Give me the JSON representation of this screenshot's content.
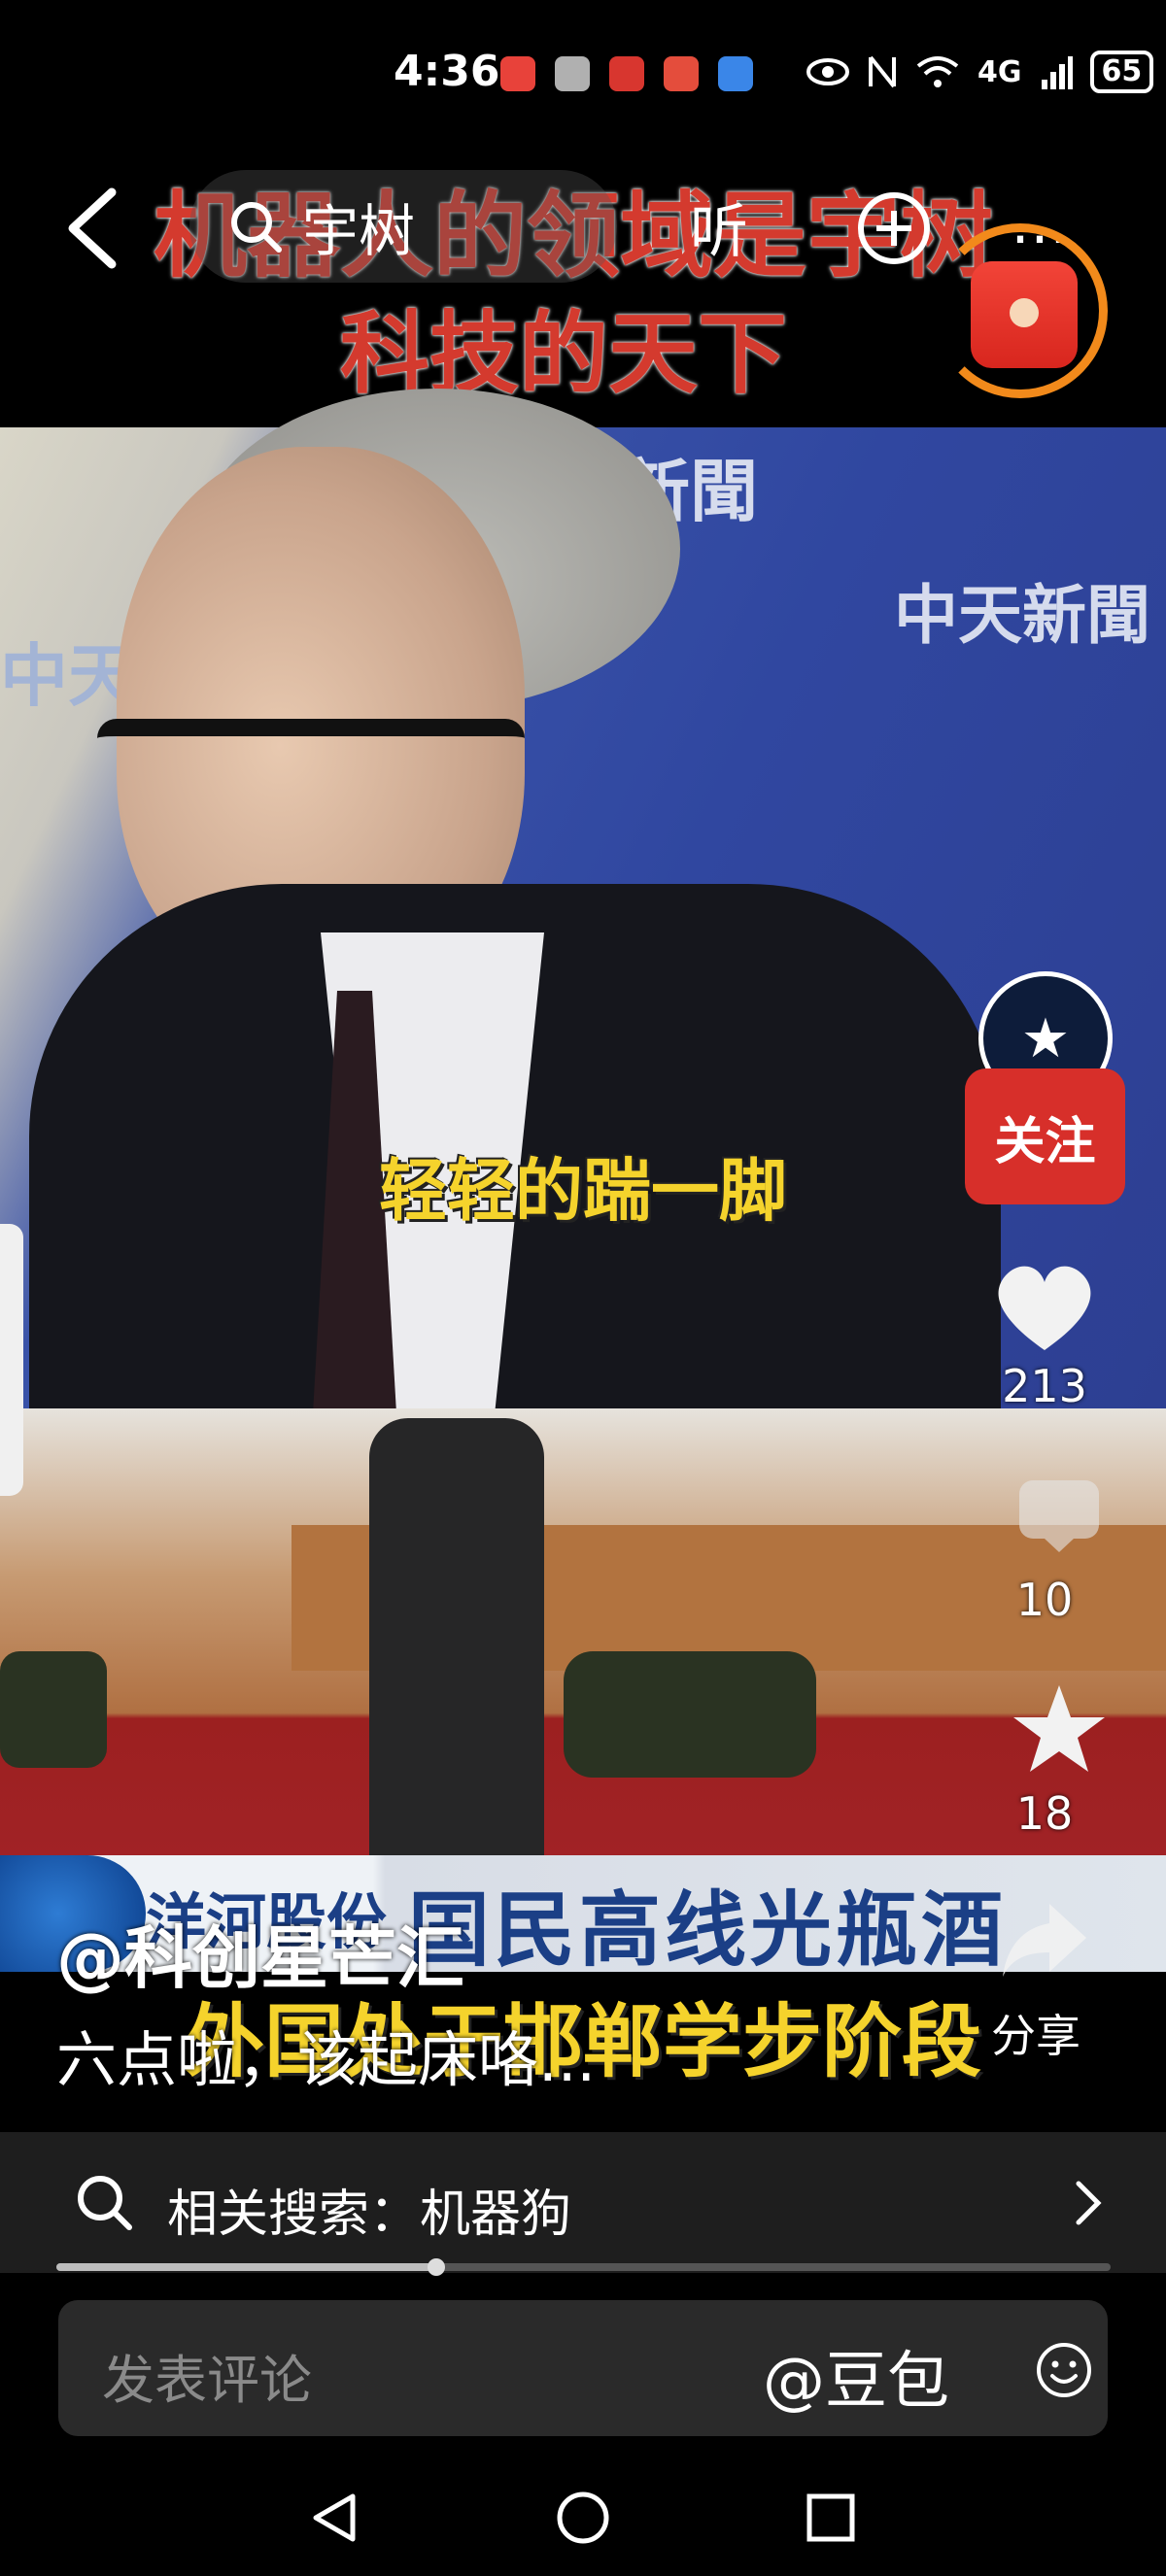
{
  "status_bar": {
    "time": "4:36",
    "network": "4G",
    "battery": "65",
    "app_icon_colors": [
      "#e8423a",
      "#b0b0b0",
      "#d8362f",
      "#e44d3c",
      "#3a86e8"
    ]
  },
  "nav": {
    "search_query": "宇树",
    "listen_label": "听"
  },
  "video": {
    "title_line_1": "机器人的领域是宇树",
    "title_line_2": "科技的天下",
    "caption_1": "轻轻的踹一脚",
    "ticker_brand": "洋河股份",
    "ticker_text": "国民高线光瓶酒",
    "caption_2": "外国处于邯郸学步阶段",
    "bg_words": [
      "新聞",
      "中天新聞",
      "中天"
    ]
  },
  "right_rail": {
    "follow_label": "关注",
    "like_count": "213",
    "comment_count": "10",
    "favorite_count": "18",
    "share_label": "分享"
  },
  "post": {
    "author": "@科创星芒汇",
    "description": "六点啦，该起床咯..."
  },
  "related": {
    "label": "相关搜索：机器狗"
  },
  "progress": {
    "fraction": 0.36
  },
  "comment": {
    "placeholder": "发表评论",
    "at_label": "@豆包"
  },
  "colors": {
    "accent_red": "#d72f2a",
    "caption_yellow": "#f5d32c",
    "title_red": "#d43a2e"
  }
}
